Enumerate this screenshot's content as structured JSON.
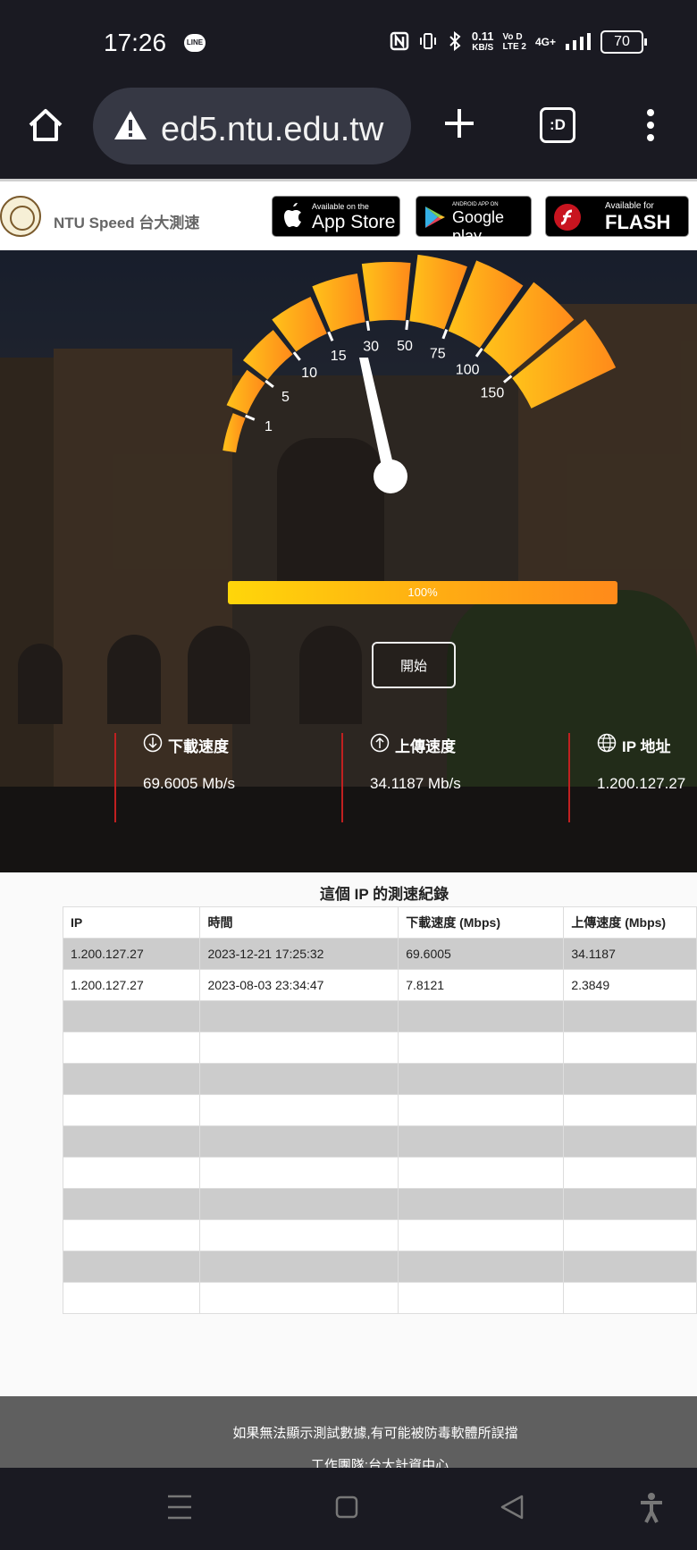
{
  "status_bar": {
    "time": "17:26",
    "line_badge": "LINE",
    "net_speed_value": "0.11",
    "net_speed_unit": "KB/S",
    "volte_top": "Vo D",
    "volte_bottom": "LTE 2",
    "network": "4G+",
    "battery": "70"
  },
  "browser": {
    "url": "ed5.ntu.edu.tw",
    "tabs_label": ":D"
  },
  "site_header": {
    "title": "NTU Speed 台大測速",
    "appstore_small": "Available on the",
    "appstore_big": "App Store",
    "google_small": "ANDROID APP ON",
    "google_big": "Google play",
    "flash_small": "Available for",
    "flash_big": "FLASH"
  },
  "gauge": {
    "ticks": [
      "1",
      "5",
      "10",
      "15",
      "30",
      "50",
      "75",
      "100",
      "150"
    ],
    "accent_start": "#ffd60a",
    "accent_end": "#ff8a1a"
  },
  "progress": {
    "label": "100%",
    "percent": 100
  },
  "start_button": "開始",
  "stats": {
    "download_label": "下載速度",
    "download_value": "69.6005 Mb/s",
    "upload_label": "上傳速度",
    "upload_value": "34.1187 Mb/s",
    "ip_label": "IP 地址",
    "ip_value": "1.200.127.27"
  },
  "records": {
    "title": "這個 IP 的測速紀錄",
    "headers": [
      "IP",
      "時間",
      "下載速度 (Mbps)",
      "上傳速度 (Mbps)"
    ],
    "rows": [
      [
        "1.200.127.27",
        "2023-12-21 17:25:32",
        "69.6005",
        "34.1187"
      ],
      [
        "1.200.127.27",
        "2023-08-03 23:34:47",
        "7.8121",
        "2.3849"
      ],
      [
        "",
        "",
        "",
        ""
      ],
      [
        "",
        "",
        "",
        ""
      ],
      [
        "",
        "",
        "",
        ""
      ],
      [
        "",
        "",
        "",
        ""
      ],
      [
        "",
        "",
        "",
        ""
      ],
      [
        "",
        "",
        "",
        ""
      ],
      [
        "",
        "",
        "",
        ""
      ],
      [
        "",
        "",
        "",
        ""
      ],
      [
        "",
        "",
        "",
        ""
      ],
      [
        "",
        "",
        "",
        ""
      ]
    ]
  },
  "footer": {
    "line1": "如果無法顯示測試數據,有可能被防毒軟體所誤擋",
    "line2": "工作團隊:台大計資中心"
  }
}
